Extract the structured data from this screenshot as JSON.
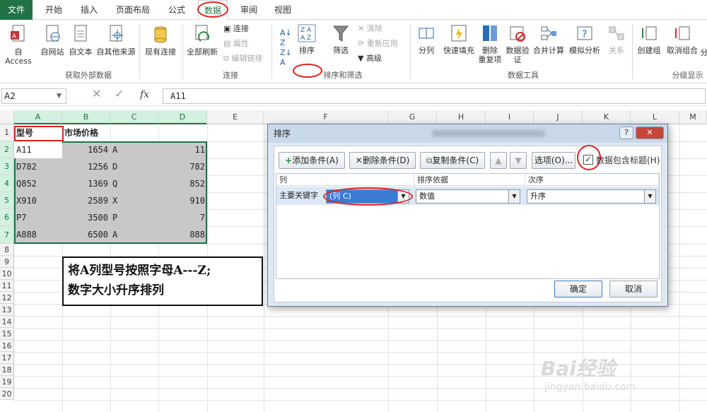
{
  "ribbon_tabs": [
    "文件",
    "开始",
    "插入",
    "页面布局",
    "公式",
    "数据",
    "审阅",
    "视图"
  ],
  "ribbon": {
    "get_external": {
      "btns": [
        "自 Access",
        "自网站",
        "自文本",
        "自其他来源",
        "现有连接"
      ],
      "label": "获取外部数据"
    },
    "connections": {
      "refresh": "全部刷新",
      "items": [
        "连接",
        "属性",
        "编辑链接"
      ],
      "label": "连接"
    },
    "sort_filter": {
      "sort": "排序",
      "filter": "筛选",
      "items": [
        "清除",
        "重新应用",
        "高级"
      ],
      "label": "排序和筛选"
    },
    "data_tools": {
      "btns": [
        "分列",
        "快速填充",
        "删除\n重复项",
        "数据验\n证",
        "合并计算",
        "模拟分析",
        "关系"
      ],
      "label": "数据工具"
    },
    "outline": {
      "btns": [
        "创建组",
        "取消组合",
        "分"
      ],
      "label": "分级显示"
    }
  },
  "formula_bar": {
    "name_box": "A2",
    "fx": "fx",
    "value": "A11"
  },
  "columns": [
    "A",
    "B",
    "C",
    "D",
    "E",
    "F",
    "G",
    "H",
    "I",
    "J",
    "K",
    "L",
    "M"
  ],
  "rows": [
    "1",
    "2",
    "3",
    "4",
    "5",
    "6",
    "7",
    "8",
    "9",
    "10",
    "11",
    "12",
    "13",
    "14",
    "15",
    "16",
    "17",
    "18",
    "19",
    "20"
  ],
  "sheet": {
    "header": [
      "型号",
      "市场价格"
    ],
    "data": [
      [
        "A11",
        "1654",
        "A",
        "11"
      ],
      [
        "D782",
        "1256",
        "D",
        "782"
      ],
      [
        "Q852",
        "1369",
        "Q",
        "852"
      ],
      [
        "X910",
        "2589",
        "X",
        "910"
      ],
      [
        "P7",
        "3500",
        "P",
        "7"
      ],
      [
        "A888",
        "6500",
        "A",
        "888"
      ]
    ]
  },
  "note": [
    "将A列型号按照字母A---Z;",
    "数字大小升序排列"
  ],
  "dialog": {
    "title": "排序",
    "help": "?",
    "close": "✕",
    "add": "添加条件(A)",
    "delete": "删除条件(D)",
    "copy": "复制条件(C)",
    "options": "选项(O)...",
    "has_header": "数据包含标题(H)",
    "col_headers": [
      "列",
      "排序依据",
      "次序"
    ],
    "row_label": "主要关键字",
    "key": "(列 C)",
    "sort_on": "数值",
    "order": "升序",
    "ok": "确定",
    "cancel": "取消"
  },
  "watermark": [
    "Bai经验",
    "jingyan.baidu.com"
  ],
  "colors": {
    "accent": "#217346",
    "circle": "#e02020"
  }
}
